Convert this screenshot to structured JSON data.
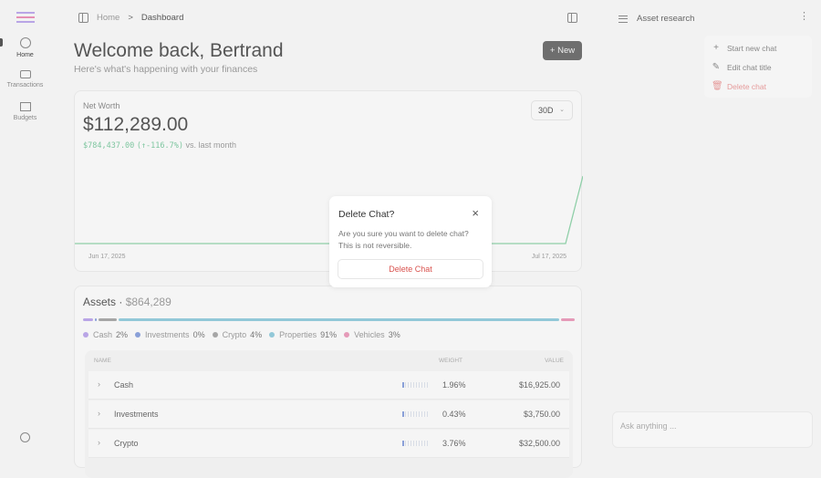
{
  "sidebar": {
    "items": [
      {
        "label": "Home"
      },
      {
        "label": "Transactions"
      },
      {
        "label": "Budgets"
      }
    ]
  },
  "breadcrumb": {
    "home": "Home",
    "current": "Dashboard",
    "sep": ">"
  },
  "header": {
    "title": "Welcome back, Bertrand",
    "subtitle": "Here's what's happening with your finances",
    "new_label": "New"
  },
  "net_worth": {
    "label": "Net Worth",
    "value": "$112,289.00",
    "change_amount": "$784,437.00",
    "change_pct": "(↑-116.7%)",
    "change_suffix": "vs. last month",
    "period": "30D",
    "start_date": "Jun 17, 2025",
    "end_date": "Jul 17, 2025"
  },
  "assets": {
    "title": "Assets",
    "total": "$864,289",
    "legend": [
      {
        "name": "Cash",
        "pct": "2%",
        "color": "#b9a5e6"
      },
      {
        "name": "Investments",
        "pct": "0%",
        "color": "#8aa0d8"
      },
      {
        "name": "Crypto",
        "pct": "4%",
        "color": "#a6a6a6"
      },
      {
        "name": "Properties",
        "pct": "91%",
        "color": "#92c8d8"
      },
      {
        "name": "Vehicles",
        "pct": "3%",
        "color": "#e59ab8"
      }
    ],
    "columns": {
      "name": "NAME",
      "weight": "WEIGHT",
      "value": "VALUE"
    },
    "rows": [
      {
        "name": "Cash",
        "weight": "1.96%",
        "value": "$16,925.00"
      },
      {
        "name": "Investments",
        "weight": "0.43%",
        "value": "$3,750.00"
      },
      {
        "name": "Crypto",
        "weight": "3.76%",
        "value": "$32,500.00"
      }
    ]
  },
  "chat": {
    "title": "Asset research",
    "menu": [
      {
        "label": "Start new chat"
      },
      {
        "label": "Edit chat title"
      },
      {
        "label": "Delete chat"
      }
    ],
    "input_placeholder": "Ask anything ..."
  },
  "modal": {
    "title": "Delete Chat?",
    "body": "Are you sure you want to delete chat? This is not reversible.",
    "confirm": "Delete Chat"
  }
}
